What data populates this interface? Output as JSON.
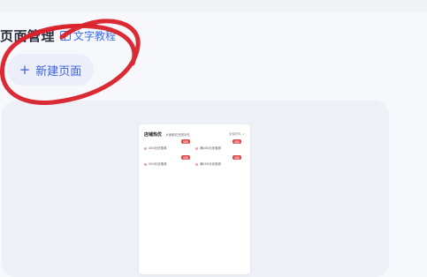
{
  "header": {
    "title": "页面管理",
    "doc_link": "文字教程"
  },
  "actions": {
    "new_page": "新建页面",
    "plus": "+"
  },
  "preview": {
    "title": "店铺热优",
    "subtitle": "大家都在抢的好礼",
    "more": "全部好礼 >",
    "items": [
      {
        "label": "400元优惠券",
        "tag": "领取"
      },
      {
        "label": "满400元优惠券",
        "tag": "领取"
      },
      {
        "label": "200元优惠券",
        "tag": "领取"
      },
      {
        "label": "满200元优惠券",
        "tag": "领取"
      }
    ]
  },
  "colors": {
    "accent": "#3d63e0",
    "annotation": "#d8202a",
    "tag": "#e04848"
  }
}
